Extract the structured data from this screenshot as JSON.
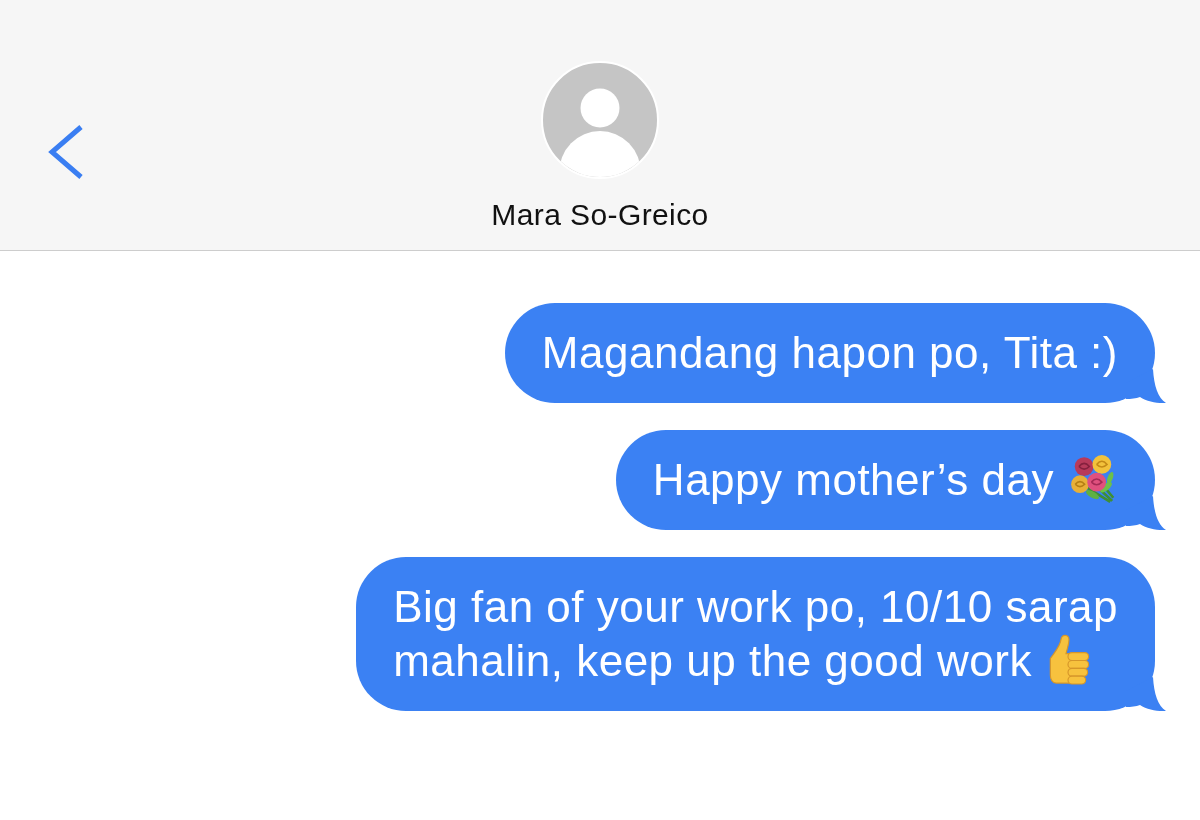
{
  "header": {
    "contact_name": "Mara So-Greico"
  },
  "messages": [
    {
      "kind": "sent",
      "lines": [
        "Magandang hapon po, Tita :)"
      ]
    },
    {
      "kind": "sent",
      "lines": [
        "Happy mother’s day"
      ],
      "emoji": {
        "kind": "bouquet"
      }
    },
    {
      "kind": "sent",
      "lines": [
        "Big fan of your work po, 10/10 sarap",
        "mahalin, keep up the good work"
      ],
      "emoji": {
        "kind": "thumbs_up"
      }
    }
  ]
}
